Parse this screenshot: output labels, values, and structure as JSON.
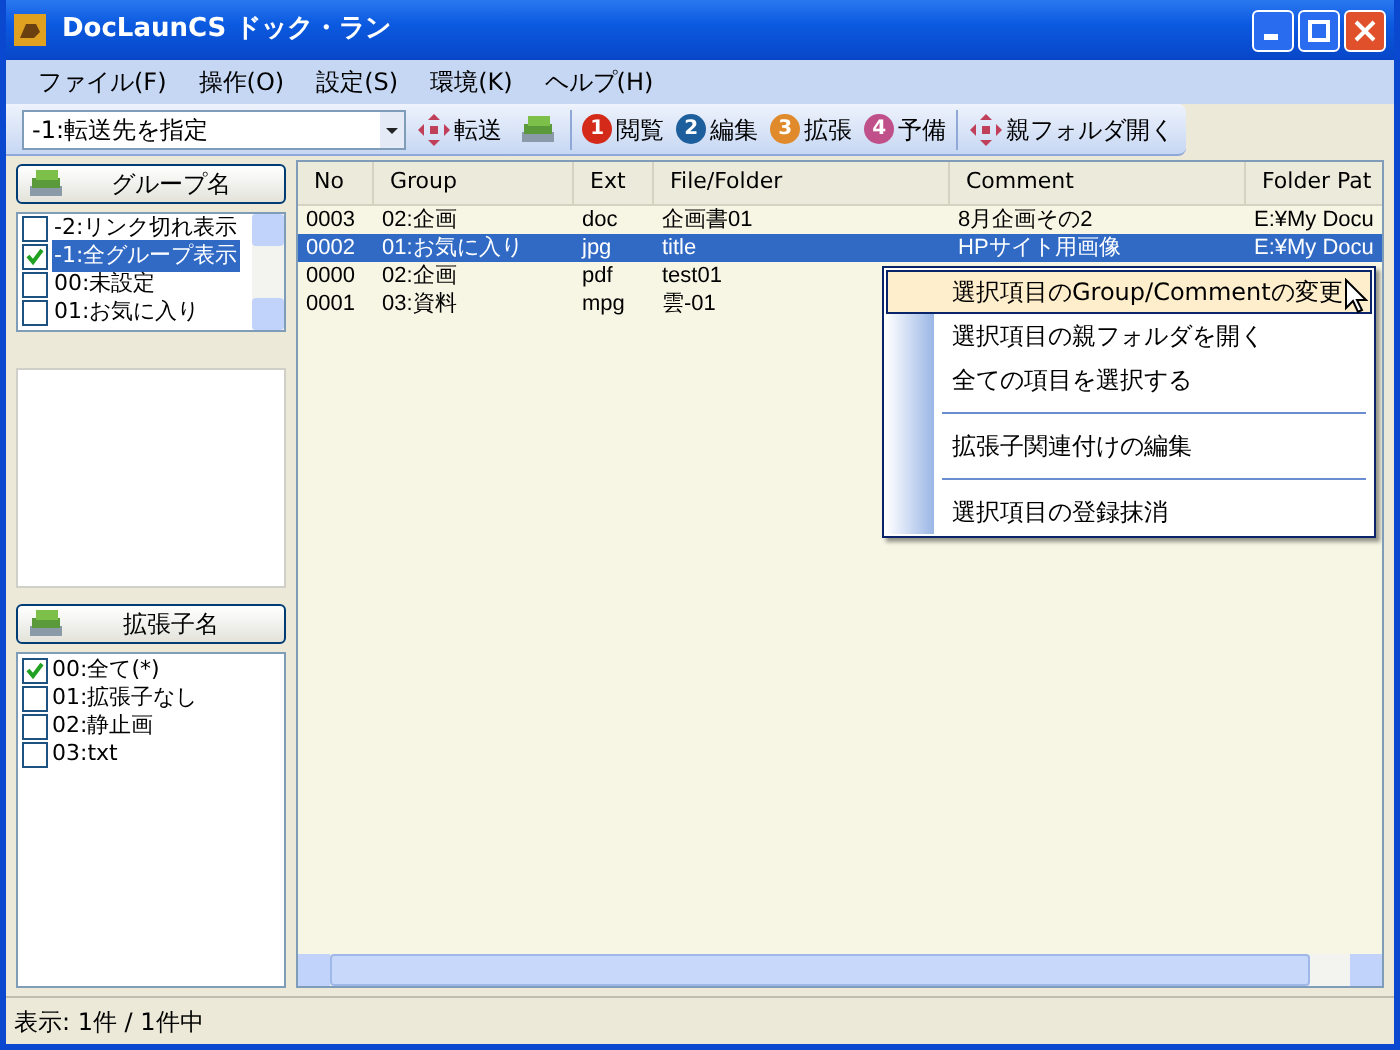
{
  "window": {
    "title": "DocLaunCS ドック・ラン"
  },
  "menu_bar": [
    "ファイル(F)",
    "操作(O)",
    "設定(S)",
    "環境(K)",
    "ヘルプ(H)"
  ],
  "toolbar": {
    "destination": {
      "value": "-1:転送先を指定"
    },
    "buttons": [
      {
        "kind": "transfer",
        "label": "転送"
      },
      {
        "kind": "books"
      },
      {
        "kind": "separator"
      },
      {
        "kind": "numbered",
        "number": "1",
        "color": "#d42a1a",
        "label": "閲覧"
      },
      {
        "kind": "numbered",
        "number": "2",
        "color": "#1d5f9c",
        "label": "編集"
      },
      {
        "kind": "numbered",
        "number": "3",
        "color": "#e08a2c",
        "label": "拡張"
      },
      {
        "kind": "numbered",
        "number": "4",
        "color": "#c0508a",
        "label": "予備"
      },
      {
        "kind": "separator"
      },
      {
        "kind": "transfer",
        "label": "親フォルダ開く"
      }
    ]
  },
  "group_panel": {
    "header": "グループ名",
    "items": [
      {
        "label": "-2:リンク切れ表示",
        "checked": false,
        "selected": false
      },
      {
        "label": "-1:全グループ表示",
        "checked": true,
        "selected": true
      },
      {
        "label": "00:未設定",
        "checked": false,
        "selected": false
      },
      {
        "label": "01:お気に入り",
        "checked": false,
        "selected": false
      }
    ]
  },
  "ext_panel": {
    "header": "拡張子名",
    "items": [
      {
        "label": "00:全て(*)",
        "checked": true
      },
      {
        "label": "01:拡張子なし",
        "checked": false
      },
      {
        "label": "02:静止画",
        "checked": false
      },
      {
        "label": "03:txt",
        "checked": false
      }
    ]
  },
  "table": {
    "columns": [
      "No",
      "Group",
      "Ext",
      "File/Folder",
      "Comment",
      "Folder Pat"
    ],
    "rows": [
      {
        "cells": [
          "0003",
          "02:企画",
          "doc",
          "企画書01",
          "8月企画その2",
          "E:¥My Docu"
        ],
        "selected": false
      },
      {
        "cells": [
          "0002",
          "01:お気に入り",
          "jpg",
          "title",
          "HPサイト用画像",
          "E:¥My Docu"
        ],
        "selected": true
      },
      {
        "cells": [
          "0000",
          "02:企画",
          "pdf",
          "test01"
        ],
        "selected": false
      },
      {
        "cells": [
          "0001",
          "03:資料",
          "mpg",
          "雲-01"
        ],
        "selected": false
      }
    ]
  },
  "context_menu": [
    {
      "kind": "item",
      "label": "選択項目のGroup/Commentの変更",
      "selected": true
    },
    {
      "kind": "item",
      "label": "選択項目の親フォルダを開く",
      "selected": false
    },
    {
      "kind": "item",
      "label": "全ての項目を選択する",
      "selected": false
    },
    {
      "kind": "separator"
    },
    {
      "kind": "item",
      "label": "拡張子関連付けの編集",
      "selected": false
    },
    {
      "kind": "separator"
    },
    {
      "kind": "item",
      "label": "選択項目の登録抹消",
      "selected": false
    }
  ],
  "status_bar": "表示: 1件 / 1件中"
}
